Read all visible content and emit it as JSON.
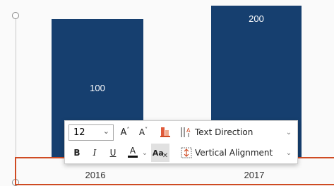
{
  "chart_data": {
    "type": "bar",
    "categories": [
      "2016",
      "2017"
    ],
    "values": [
      100,
      200
    ],
    "data_labels": [
      "100",
      "200"
    ],
    "colors": {
      "bar": "#163f6f",
      "axis_selection": "#cf4b23"
    }
  },
  "toolbar": {
    "font_size": "12",
    "increase_font_label": "A",
    "decrease_font_label": "A",
    "text_direction_label": "Text Direction",
    "bold_label": "B",
    "italic_label": "I",
    "underline_label": "U",
    "font_color_label": "A",
    "clear_format_label": "Aa",
    "vertical_alignment_label": "Vertical Alignment",
    "icons": [
      "chevron-down-icon",
      "increase-font-icon",
      "decrease-font-icon",
      "highlight-icon",
      "text-direction-icon",
      "font-color-icon",
      "clear-formatting-icon",
      "vertical-alignment-icon"
    ]
  }
}
